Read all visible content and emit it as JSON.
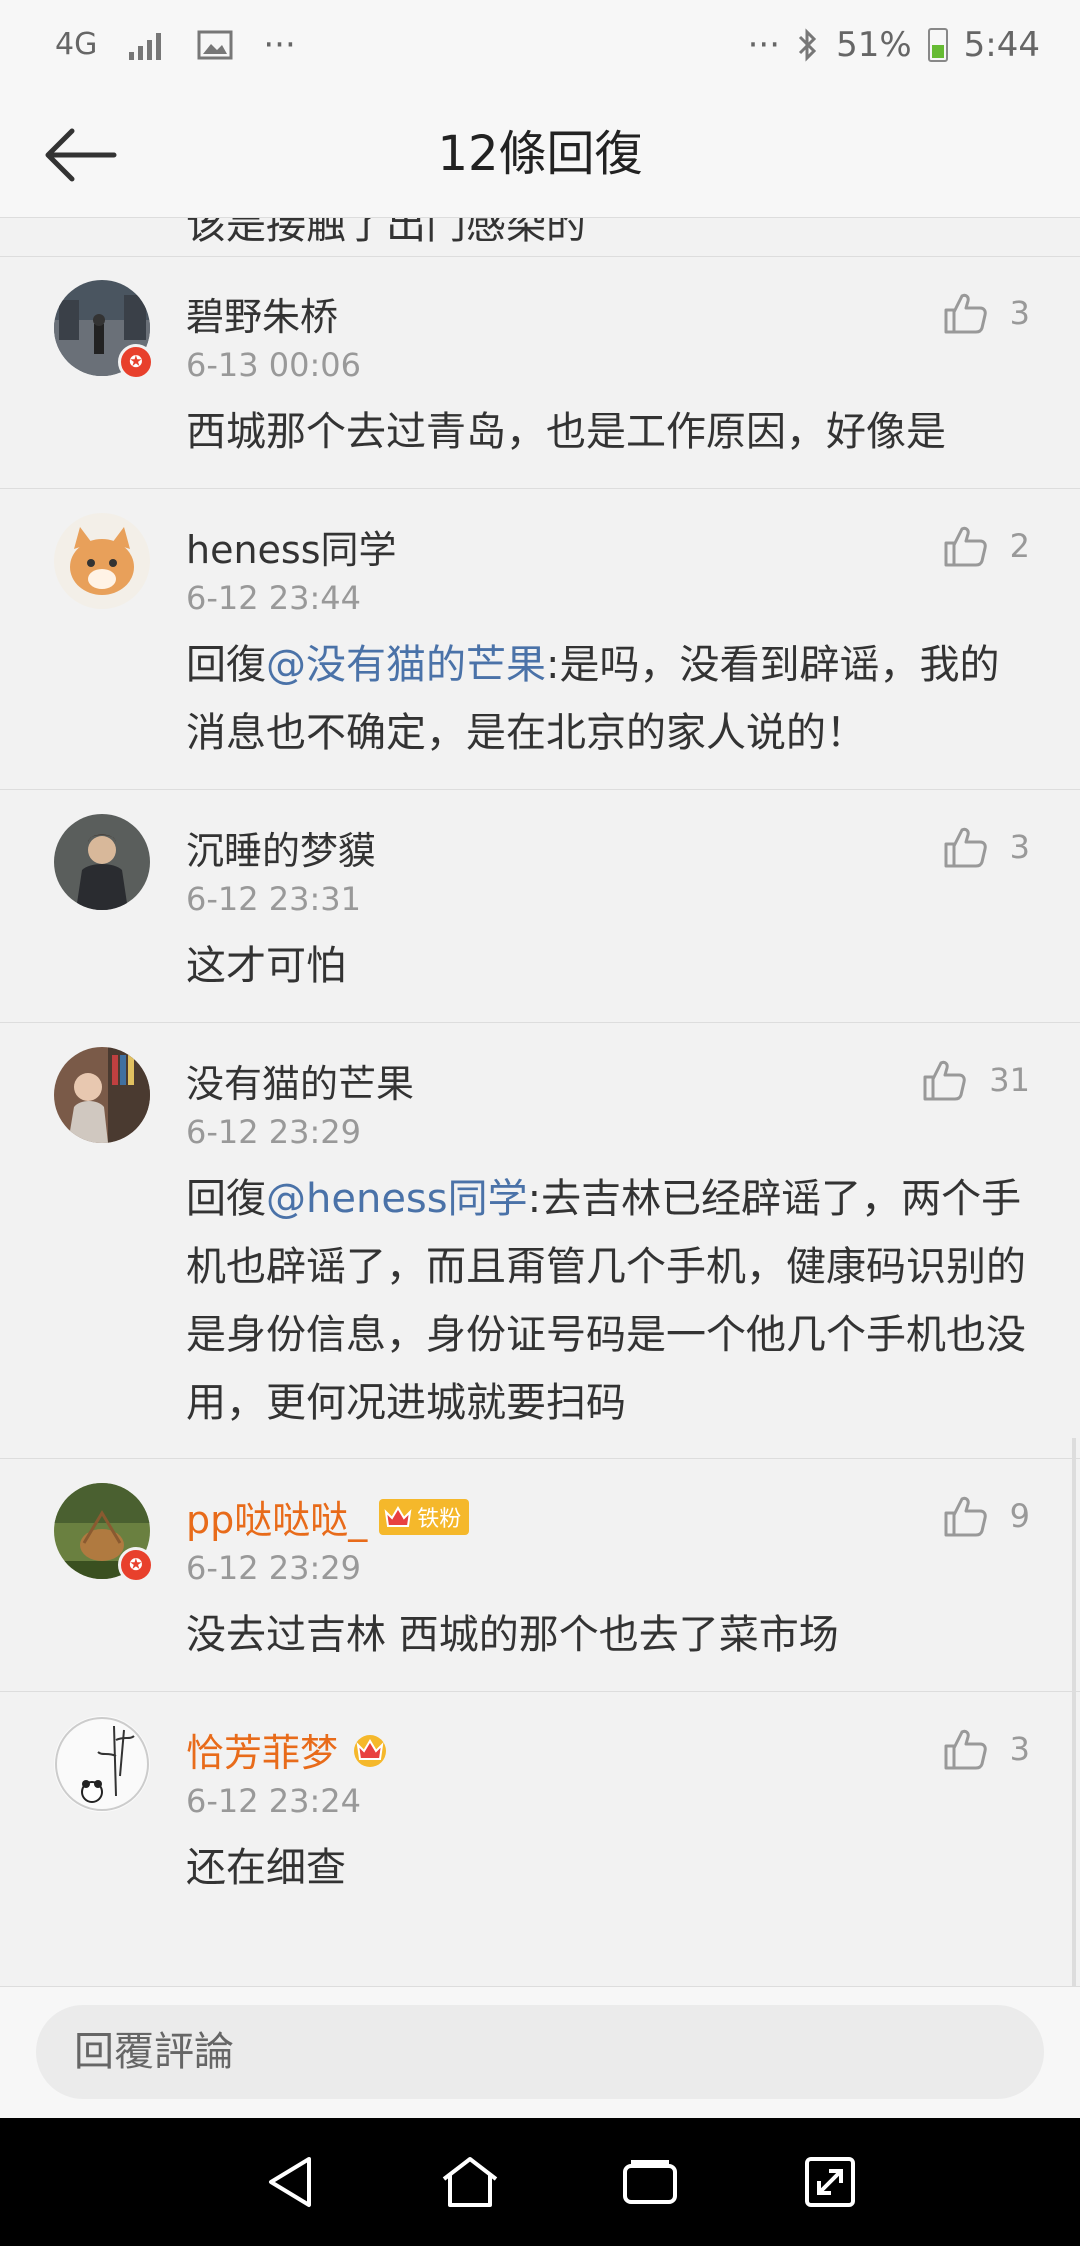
{
  "status_bar": {
    "network": "4G",
    "dots": "···",
    "battery_percent": "51%",
    "time": "5:44"
  },
  "header": {
    "title": "12條回復",
    "back_icon": "arrow-left-icon"
  },
  "partial_text": "该是接触了出门感染的",
  "comments": [
    {
      "username": "碧野朱桥",
      "time": "6-13 00:06",
      "likes": "3",
      "text": "西城那个去过青岛，也是工作原因，好像是",
      "verified": true
    },
    {
      "username": "heness同学",
      "time": "6-12 23:44",
      "likes": "2",
      "prefix": "回復",
      "mention": "@没有猫的芒果",
      "text": ":是吗，没看到辟谣，我的消息也不确定，是在北京的家人说的！"
    },
    {
      "username": "沉睡的梦貘",
      "time": "6-12 23:31",
      "likes": "3",
      "text": "这才可怕"
    },
    {
      "username": "没有猫的芒果",
      "time": "6-12 23:29",
      "likes": "31",
      "prefix": "回復",
      "mention": "@heness同学",
      "text": ":去吉林已经辟谣了，两个手机也辟谣了，而且甭管几个手机，健康码识别的是身份信息，身份证号码是一个他几个手机也没用，更何况进城就要扫码"
    },
    {
      "username": "pp哒哒哒_",
      "time": "6-12 23:29",
      "likes": "9",
      "text": "没去过吉林 西城的那个也去了菜市场",
      "verified": true,
      "badge": "铁粉"
    },
    {
      "username": "恰芳菲梦",
      "time": "6-12 23:24",
      "likes": "3",
      "text": "还在细查"
    }
  ],
  "reply_bar": {
    "placeholder": "回覆評論"
  },
  "colors": {
    "mention": "#4a72a8",
    "vip_name": "#e86b1a",
    "badge": "#f5b82b"
  }
}
